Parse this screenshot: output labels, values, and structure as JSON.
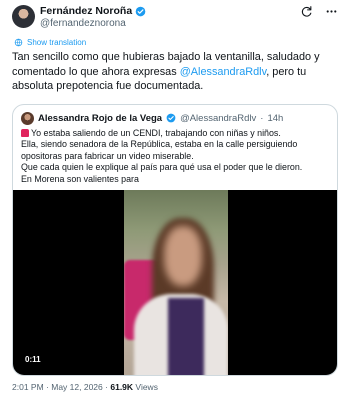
{
  "author": {
    "name": "Fernández Noroña",
    "handle": "@fernandeznorona"
  },
  "actions": {
    "show_translation": "Show translation"
  },
  "tweet": {
    "text_before": "Tan sencillo como que hubieras bajado la ventanilla, saludado y comentado lo que ahora expresas ",
    "mention": "@AlessandraRdlv",
    "text_after": ", pero tu absoluta prepotencia fue documentada."
  },
  "quote": {
    "name": "Alessandra Rojo de la Vega",
    "handle": "@AlessandraRdlv",
    "separator": "·",
    "time": "14h",
    "lines": [
      "Yo estaba saliendo de un CENDI, trabajando con niñas y niños.",
      "Ella, siendo senadora de la República, estaba en la calle persiguiendo opositoras para fabricar un video miserable.",
      "Que cada quien le explique al país para qué usa el poder que le dieron.",
      "En Morena son valientes para"
    ],
    "video_time": "0:11"
  },
  "meta": {
    "time": "2:01 PM",
    "sep1": "·",
    "date": "May 12, 2026",
    "sep2": "·",
    "views": "61.9K",
    "views_label": "Views"
  },
  "colors": {
    "accent": "#1d9bf0",
    "verified": "#1d9bf0",
    "text": "#0f1419",
    "muted": "#536471",
    "border": "#cfd9de"
  }
}
